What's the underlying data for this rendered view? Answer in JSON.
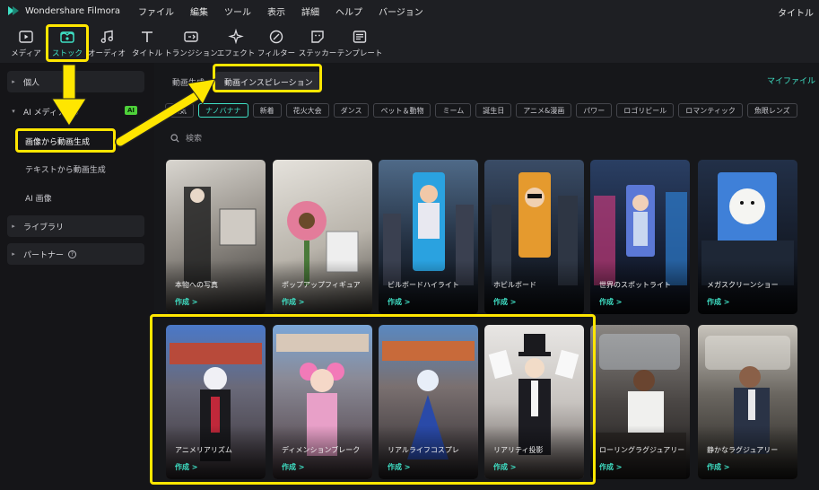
{
  "app": {
    "name": "Wondershare Filmora",
    "window_title": "タイトル"
  },
  "menu": [
    "ファイル",
    "編集",
    "ツール",
    "表示",
    "詳細",
    "ヘルプ",
    "バージョン"
  ],
  "toolbar": [
    {
      "label": "メディア",
      "icon": "media-icon"
    },
    {
      "label": "ストック",
      "icon": "stock-icon",
      "active": true
    },
    {
      "label": "オーディオ",
      "icon": "music-note-icon"
    },
    {
      "label": "タイトル",
      "icon": "title-T-icon"
    },
    {
      "label": "トランジション",
      "icon": "transition-icon"
    },
    {
      "label": "エフェクト",
      "icon": "effect-sparkle-icon"
    },
    {
      "label": "フィルター",
      "icon": "filter-icon"
    },
    {
      "label": "ステッカー",
      "icon": "sticker-icon"
    },
    {
      "label": "テンプレート",
      "icon": "template-icon"
    }
  ],
  "sidebar": {
    "personal": "個人",
    "ai_media": "AI メディア",
    "ai_badge": "AI",
    "items": [
      "画像から動画生成",
      "テキストから動画生成",
      "AI 画像"
    ],
    "library": "ライブラリ",
    "partner": "パートナー"
  },
  "main": {
    "tab_generate": "動画生成",
    "tab_inspiration": "動画インスピレーション",
    "my_files": "マイファイル",
    "chips": [
      "人気",
      "ナノバナナ",
      "新着",
      "花火大会",
      "ダンス",
      "ペット＆動物",
      "ミーム",
      "誕生日",
      "アニメ&漫画",
      "パワー",
      "ロゴリビール",
      "ロマンティック",
      "魚眼レンズ"
    ],
    "active_chip": "ナノバナナ",
    "search_placeholder": "検索",
    "create_label": "作成 >",
    "cards": [
      {
        "title": "本物への写真"
      },
      {
        "title": "ポップアップフィギュア"
      },
      {
        "title": "ビルボードハイライト"
      },
      {
        "title": "ホビルボード"
      },
      {
        "title": "世界のスポットライト"
      },
      {
        "title": "メガスクリーンショー"
      },
      {
        "title": "アニメリアリズム"
      },
      {
        "title": "ディメンションブレーク"
      },
      {
        "title": "リアルライフコスプレ"
      },
      {
        "title": "リアリティ投影"
      },
      {
        "title": "ローリングラグジュアリー"
      },
      {
        "title": "静かなラグジュアリー"
      }
    ]
  },
  "colors": {
    "accent": "#3fe0c5",
    "highlight": "#ffe600",
    "ai_badge": "#4ed13a"
  }
}
